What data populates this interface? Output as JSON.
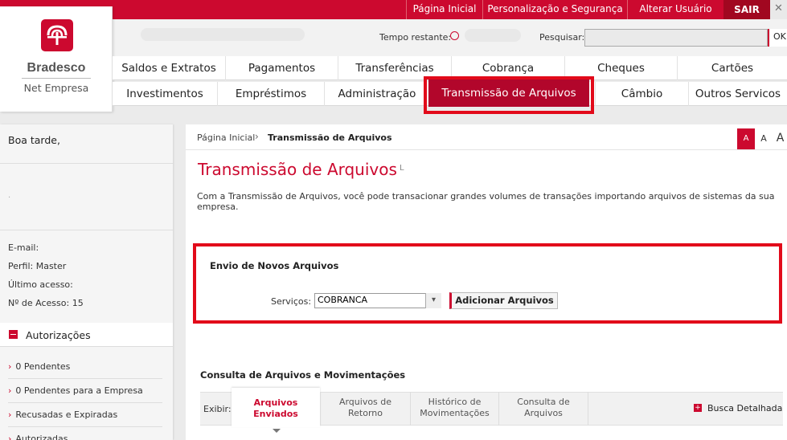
{
  "topbar": {
    "links": [
      "Página Inicial",
      "Personalização e Segurança",
      "Alterar Usuário"
    ],
    "sair": "SAIR",
    "close": "✕"
  },
  "logo": {
    "name": "Bradesco",
    "subtitle": "Net Empresa"
  },
  "header": {
    "timer_label": "Tempo restante:",
    "search_label": "Pesquisar:",
    "search_value": "",
    "search_ok": "OK"
  },
  "nav": {
    "row1": [
      "Saldos e Extratos",
      "Pagamentos",
      "Transferências",
      "Cobrança",
      "Cheques",
      "Cartões"
    ],
    "row2": [
      "Investimentos",
      "Empréstimos",
      "Administração",
      "Transmissão de Arquivos",
      "Câmbio",
      "Outros Servicos"
    ],
    "active": "Transmissão de Arquivos"
  },
  "sidebar": {
    "greeting": "Boa tarde,",
    "dot": ".",
    "info": [
      "E-mail:",
      "Perfil: Master",
      "Último acesso:",
      "Nº de Acesso: 15"
    ],
    "auth_label": "Autorizações",
    "auth_items": [
      "0 Pendentes",
      "0 Pendentes para a Empresa",
      "Recusadas e Expiradas",
      "Autorizadas"
    ]
  },
  "content": {
    "breadcrumb_home": "Página Inicial",
    "breadcrumb_sep": "›",
    "breadcrumb_current": "Transmissão de Arquivos",
    "font_sizes": [
      "A",
      "A",
      "A"
    ],
    "title": "Transmissão de Arquivos",
    "title_mark": "L",
    "description": "Com a Transmissão de Arquivos, você pode transacionar grandes volumes de transações importando arquivos de sistemas da sua empresa.",
    "envio": {
      "title": "Envio de Novos Arquivos",
      "services_label": "Serviços:",
      "services_value": "COBRANCA",
      "add_button": "Adicionar Arquivos"
    },
    "consulta": {
      "title": "Consulta de Arquivos e Movimentações",
      "exibir": "Exibir:",
      "tabs": [
        {
          "l1": "Arquivos",
          "l2": "Enviados"
        },
        {
          "l1": "Arquivos de",
          "l2": "Retorno"
        },
        {
          "l1": "Histórico de",
          "l2": "Movimentações"
        },
        {
          "l1": "Consulta de",
          "l2": "Arquivos"
        }
      ],
      "busca_icon": "+",
      "busca": "Busca Detalhada"
    }
  },
  "colors": {
    "brand": "#cc092f",
    "highlight": "#e20a1a"
  }
}
